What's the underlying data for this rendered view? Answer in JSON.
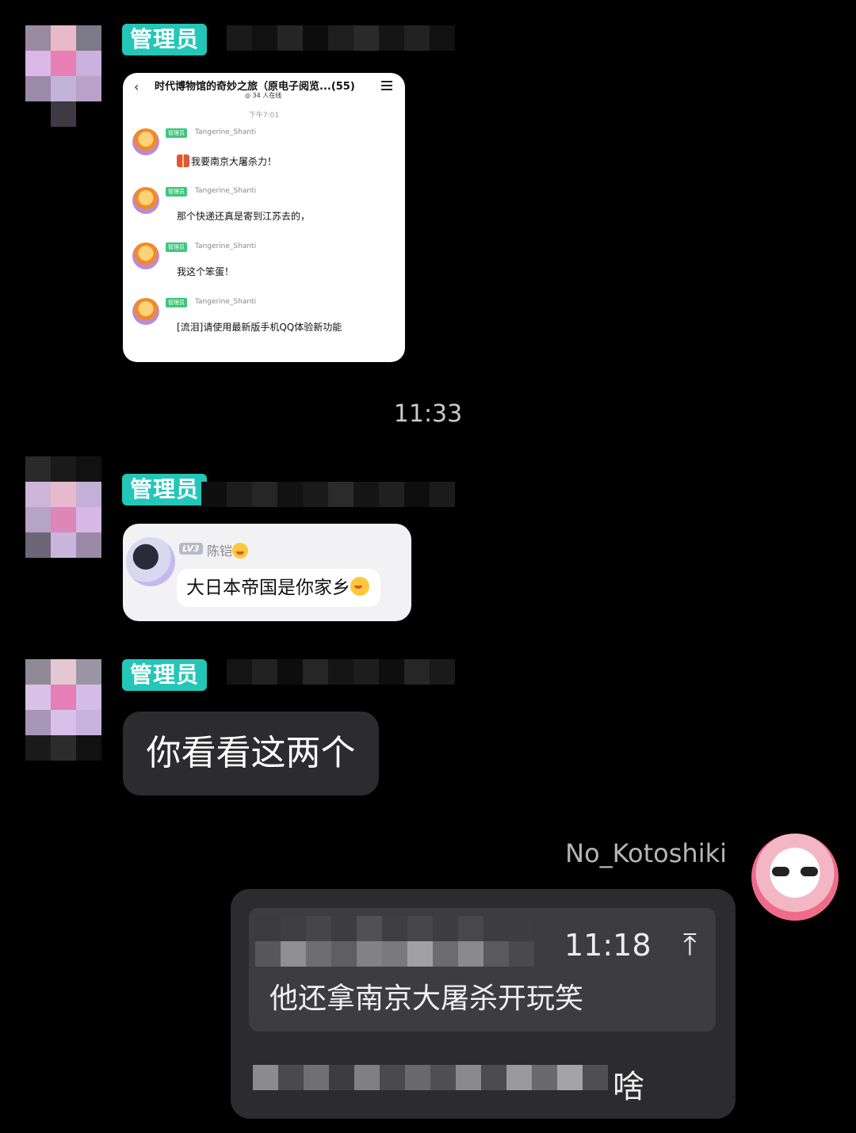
{
  "colors": {
    "background": "#000000",
    "admin_badge": "#22c7b8",
    "dark_bubble": "#2c2c2e",
    "quote_box": "#3d3d40",
    "admin_tag_small": "#3cc77a"
  },
  "messages": [
    {
      "badge": "管理员",
      "type": "image",
      "screenshot": {
        "title": "时代博物馆的奇妙之旅（原电子阅览...(55)",
        "online": "34 人在线",
        "time": "下午7:01",
        "items": [
          {
            "tag": "管理员",
            "user": "Tangerine_Shanti",
            "text": "我要南京大屠杀力！"
          },
          {
            "tag": "管理员",
            "user": "Tangerine_Shanti",
            "text": "那个快递还真是寄到江苏去的，"
          },
          {
            "tag": "管理员",
            "user": "Tangerine_Shanti",
            "text": "我这个笨蛋！"
          },
          {
            "tag": "管理员",
            "user": "Tangerine_Shanti",
            "text": "[流泪]请使用最新版手机QQ体验新功能"
          }
        ]
      }
    },
    {
      "badge": "管理员",
      "type": "image",
      "screenshot": {
        "level": "LV3",
        "name": "陈铠",
        "text": "大日本帝国是你家乡"
      }
    },
    {
      "badge": "管理员",
      "type": "text",
      "text": "你看看这两个"
    },
    {
      "type": "reply",
      "sender": "No_Kotoshiki",
      "quote_time": "11:18",
      "quote_text": "他还拿南京大屠杀开玩笑",
      "reply_visible_tail": "啥"
    }
  ],
  "time_divider": "11:33",
  "icons": [
    "back-arrow-icon",
    "menu-icon",
    "gift-icon",
    "laugh-emoji-icon",
    "yum-emoji-icon",
    "jump-up-icon"
  ]
}
